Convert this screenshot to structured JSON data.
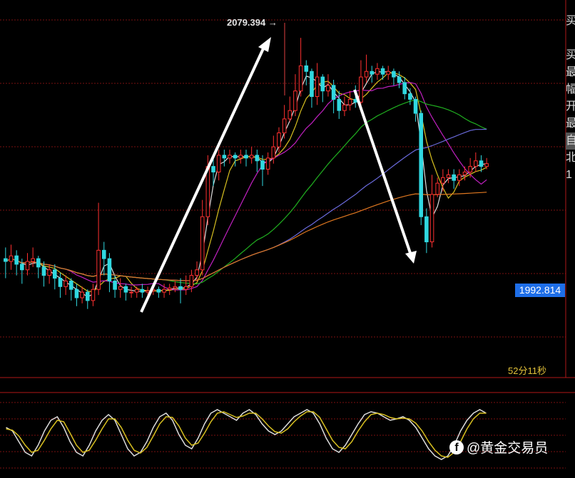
{
  "chart_data": {
    "type": "candlestick",
    "timeframe_countdown": "52分11秒",
    "high_annotation": "2079.394",
    "current_price": "1992.814",
    "ylim": [
      1960,
      2090
    ],
    "candles": [
      [
        2000,
        1999,
        2004,
        1993
      ],
      [
        1999,
        2001,
        2005,
        1996
      ],
      [
        2001,
        1998,
        2003,
        1994
      ],
      [
        1998,
        1996,
        2000,
        1991
      ],
      [
        1996,
        1999,
        2002,
        1994
      ],
      [
        1999,
        2000,
        2004,
        1997
      ],
      [
        2000,
        1997,
        2001,
        1993
      ],
      [
        1997,
        1994,
        1999,
        1990
      ],
      [
        1994,
        1996,
        1998,
        1991
      ],
      [
        1996,
        1993,
        1998,
        1989
      ],
      [
        1993,
        1990,
        1995,
        1986
      ],
      [
        1990,
        1992,
        1994,
        1987
      ],
      [
        1992,
        1989,
        1993,
        1985
      ],
      [
        1989,
        1986,
        1991,
        1983
      ],
      [
        1986,
        1988,
        1990,
        1984
      ],
      [
        1988,
        1985,
        1989,
        1982
      ],
      [
        1985,
        1989,
        1991,
        1983
      ],
      [
        1989,
        2003,
        2020,
        1987
      ],
      [
        2003,
        2000,
        2006,
        1994
      ],
      [
        2000,
        1992,
        2002,
        1988
      ],
      [
        1992,
        1989,
        1994,
        1986
      ],
      [
        1989,
        1990,
        1993,
        1986
      ],
      [
        1990,
        1988,
        1991,
        1985
      ],
      [
        1988,
        1988,
        1990,
        1986
      ],
      [
        1988,
        1989,
        1990,
        1986
      ],
      [
        1989,
        1988,
        1991,
        1986
      ],
      [
        1988,
        1988.5,
        1990,
        1986
      ],
      [
        1988.5,
        1989,
        1991,
        1987
      ],
      [
        1989,
        1988,
        1990,
        1986
      ],
      [
        1988,
        1989,
        1991,
        1986
      ],
      [
        1989,
        1989.5,
        1991,
        1987
      ],
      [
        1989.5,
        1990,
        1992,
        1988
      ],
      [
        1990,
        1989,
        1993,
        1984
      ],
      [
        1989,
        1990,
        1994,
        1987
      ],
      [
        1990,
        1994,
        1996,
        1988
      ],
      [
        1994,
        1996,
        1999,
        1992
      ],
      [
        1996,
        2015,
        2021,
        1994
      ],
      [
        2015,
        2033,
        2037,
        2012
      ],
      [
        2033,
        2031,
        2036,
        2026
      ],
      [
        2031,
        2037,
        2039,
        2028
      ],
      [
        2037,
        2036,
        2039,
        2033
      ],
      [
        2036,
        2037,
        2039,
        2034
      ],
      [
        2037,
        2036,
        2038,
        2033
      ],
      [
        2036,
        2037,
        2039,
        2034
      ],
      [
        2037,
        2036,
        2039,
        2033
      ],
      [
        2036,
        2037,
        2040,
        2034
      ],
      [
        2037,
        2035,
        2039,
        2031
      ],
      [
        2035,
        2032,
        2037,
        2026
      ],
      [
        2032,
        2036,
        2038,
        2030
      ],
      [
        2036,
        2040,
        2044,
        2034
      ],
      [
        2040,
        2045,
        2047,
        2038
      ],
      [
        2045,
        2050,
        2055,
        2043
      ],
      [
        2050,
        2053,
        2058,
        2049
      ],
      [
        2053,
        2060,
        2066,
        2051
      ],
      [
        2060,
        2069,
        2079,
        2058
      ],
      [
        2069,
        2067,
        2071,
        2062
      ],
      [
        2067,
        2058,
        2068,
        2054
      ],
      [
        2058,
        2065,
        2070,
        2055
      ],
      [
        2065,
        2060,
        2066,
        2056
      ],
      [
        2060,
        2062,
        2066,
        2058
      ],
      [
        2062,
        2057,
        2064,
        2052
      ],
      [
        2057,
        2053,
        2060,
        2050
      ],
      [
        2053,
        2055,
        2058,
        2051
      ],
      [
        2055,
        2057,
        2060,
        2053
      ],
      [
        2057,
        2056,
        2062,
        2054
      ],
      [
        2056,
        2065,
        2071,
        2054
      ],
      [
        2065,
        2067,
        2073,
        2063
      ],
      [
        2067,
        2066,
        2069,
        2063
      ],
      [
        2066,
        2068,
        2070,
        2064
      ],
      [
        2068,
        2066,
        2069,
        2064
      ],
      [
        2066,
        2067,
        2069,
        2064
      ],
      [
        2067,
        2065,
        2068,
        2062
      ],
      [
        2065,
        2063,
        2067,
        2061
      ],
      [
        2063,
        2059,
        2065,
        2057
      ],
      [
        2059,
        2057,
        2061,
        2055
      ],
      [
        2057,
        2052,
        2058,
        2049
      ],
      [
        2052,
        2015,
        2053,
        2012
      ],
      [
        2015,
        2006,
        2018,
        2002
      ],
      [
        2006,
        2023,
        2030,
        2004
      ],
      [
        2023,
        2027,
        2029,
        2022
      ],
      [
        2027,
        2029,
        2032,
        2024
      ],
      [
        2029,
        2030,
        2032,
        2027
      ],
      [
        2030,
        2028,
        2032,
        2025
      ],
      [
        2028,
        2030,
        2032,
        2026
      ],
      [
        2030,
        2031,
        2033,
        2028
      ],
      [
        2031,
        2033,
        2036,
        2029
      ],
      [
        2033,
        2035,
        2038,
        2031
      ],
      [
        2035,
        2033,
        2037,
        2031
      ],
      [
        2033,
        2034,
        2036,
        2032
      ]
    ],
    "stochastic": {
      "k": [
        60,
        55,
        40,
        25,
        20,
        35,
        55,
        70,
        75,
        60,
        40,
        25,
        20,
        35,
        55,
        70,
        78,
        70,
        50,
        30,
        20,
        25,
        40,
        60,
        75,
        80,
        70,
        50,
        35,
        30,
        45,
        65,
        80,
        85,
        80,
        75,
        70,
        80,
        85,
        78,
        65,
        55,
        50,
        55,
        65,
        75,
        80,
        85,
        80,
        65,
        45,
        30,
        25,
        35,
        50,
        65,
        78,
        82,
        80,
        75,
        70,
        72,
        75,
        70,
        60,
        45,
        30,
        20,
        15,
        20,
        35,
        55,
        70,
        80,
        85,
        80
      ],
      "d": [
        58,
        56,
        48,
        35,
        25,
        28,
        42,
        58,
        70,
        68,
        52,
        35,
        25,
        28,
        42,
        58,
        72,
        72,
        60,
        42,
        28,
        24,
        32,
        48,
        65,
        75,
        74,
        62,
        45,
        35,
        38,
        52,
        68,
        80,
        82,
        78,
        74,
        76,
        80,
        80,
        72,
        62,
        54,
        52,
        58,
        68,
        76,
        82,
        82,
        74,
        58,
        42,
        32,
        30,
        40,
        55,
        68,
        78,
        80,
        78,
        74,
        72,
        73,
        72,
        66,
        55,
        40,
        28,
        20,
        18,
        25,
        40,
        58,
        72,
        80,
        80
      ]
    }
  }
}
